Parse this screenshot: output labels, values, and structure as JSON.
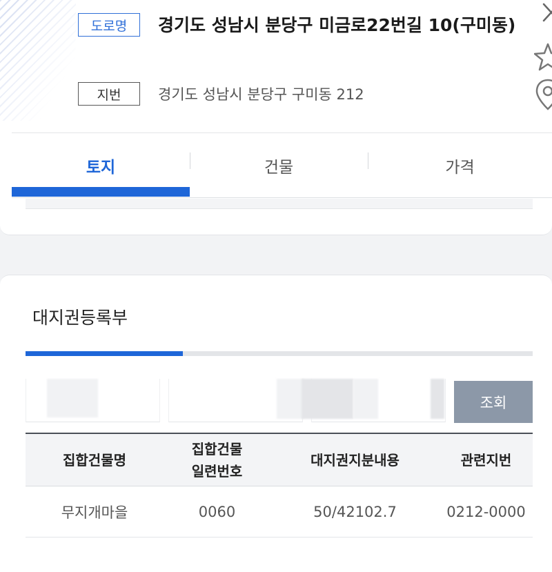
{
  "address": {
    "road_badge": "도로명",
    "road_address": "경기도 성남시 분당구 미금로22번길 10(구미동)",
    "lot_badge": "지번",
    "lot_address": "경기도 성남시 분당구 구미동 212"
  },
  "tabs": [
    {
      "label": "토지",
      "active": true
    },
    {
      "label": "건물",
      "active": false
    },
    {
      "label": "가격",
      "active": false
    }
  ],
  "section": {
    "title": "대지권등록부",
    "progress_fraction": 0.31
  },
  "search": {
    "button_label": "조회"
  },
  "table": {
    "headers": [
      "집합건물명",
      "집합건물\n일련번호",
      "대지권지분내용",
      "관련지번"
    ],
    "rows": [
      [
        "무지개마을",
        "0060",
        "50/42102.7",
        "0212-0000"
      ]
    ]
  },
  "colors": {
    "accent": "#1e66d8",
    "button_bg": "#8c98a8"
  }
}
